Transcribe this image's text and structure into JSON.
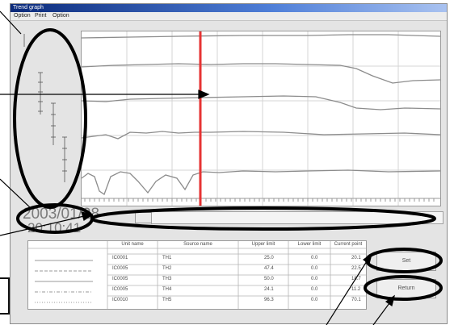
{
  "window": {
    "title": "Trend graph",
    "menu": [
      "Option",
      "Print",
      "Option"
    ]
  },
  "graph": {
    "date": "2003/01/28",
    "time": "20:10:41",
    "colors": {
      "cursor": "#e63333",
      "trend": "#8c8c8c",
      "grid": "#d0d0d0"
    }
  },
  "table": {
    "headers": [
      "Unit name",
      "Source name",
      "Upper limit",
      "Lower limit",
      "Current point"
    ],
    "rows": [
      {
        "unit": "IC0001",
        "source": "TH1",
        "upper": "25.0",
        "lower": "0.0",
        "current": "20.1"
      },
      {
        "unit": "IC0005",
        "source": "TH2",
        "upper": "47.4",
        "lower": "0.0",
        "current": "22.5"
      },
      {
        "unit": "IC0005",
        "source": "TH3",
        "upper": "50.0",
        "lower": "0.0",
        "current": "18.7"
      },
      {
        "unit": "IC0005",
        "source": "TH4",
        "upper": "24.1",
        "lower": "0.0",
        "current": "11.2"
      },
      {
        "unit": "IC0010",
        "source": "TH5",
        "upper": "96.3",
        "lower": "0.0",
        "current": "70.1"
      }
    ]
  },
  "buttons": {
    "set": "Set",
    "return": "Return"
  }
}
